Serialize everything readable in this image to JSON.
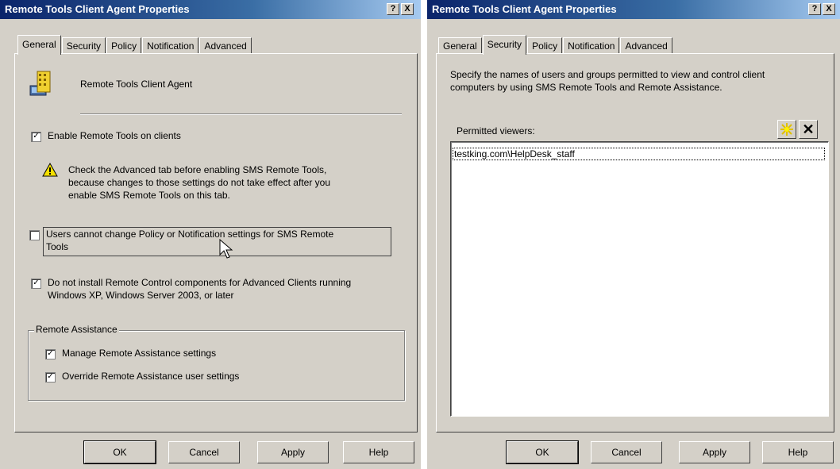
{
  "left_window": {
    "title": "Remote Tools Client Agent Properties",
    "help_btn": "?",
    "close_btn": "X",
    "tabs": [
      "General",
      "Security",
      "Policy",
      "Notification",
      "Advanced"
    ],
    "active_tab": "General",
    "agent_name": "Remote Tools Client Agent",
    "enable_label": "Enable Remote Tools on clients",
    "enable_checked": true,
    "warning_line1": "Check the Advanced tab before enabling SMS Remote Tools,",
    "warning_line2": "because changes to those settings do not take effect after you",
    "warning_line3": "enable SMS Remote Tools on this tab.",
    "users_line1": "Users cannot change Policy or Notification settings for SMS Remote",
    "users_line2": "Tools",
    "users_checked": false,
    "noinstall_line1": "Do not install Remote Control components for Advanced Clients running",
    "noinstall_line2": "Windows XP, Windows Server 2003, or later",
    "noinstall_checked": true,
    "ra_group": "Remote Assistance",
    "manage_label": "Manage Remote Assistance settings",
    "manage_checked": true,
    "override_label": "Override Remote Assistance user settings",
    "override_checked": true,
    "ok": "OK",
    "cancel": "Cancel",
    "apply": "Apply",
    "help": "Help"
  },
  "right_window": {
    "title": "Remote Tools Client Agent Properties",
    "help_btn": "?",
    "close_btn": "X",
    "tabs": [
      "General",
      "Security",
      "Policy",
      "Notification",
      "Advanced"
    ],
    "active_tab": "Security",
    "desc_line1": "Specify the names of users and groups permitted to view and control client",
    "desc_line2": "computers by using SMS Remote Tools and Remote Assistance.",
    "permitted_label": "Permitted viewers:",
    "viewers": [
      "testking.com\\HelpDesk_staff"
    ],
    "ok": "OK",
    "cancel": "Cancel",
    "apply": "Apply",
    "help": "Help"
  },
  "icons": {
    "agent": "computer-building-icon",
    "warning": "warning-icon",
    "new": "new-star-icon",
    "delete": "delete-x-icon",
    "cursor": "mouse-cursor-icon"
  }
}
